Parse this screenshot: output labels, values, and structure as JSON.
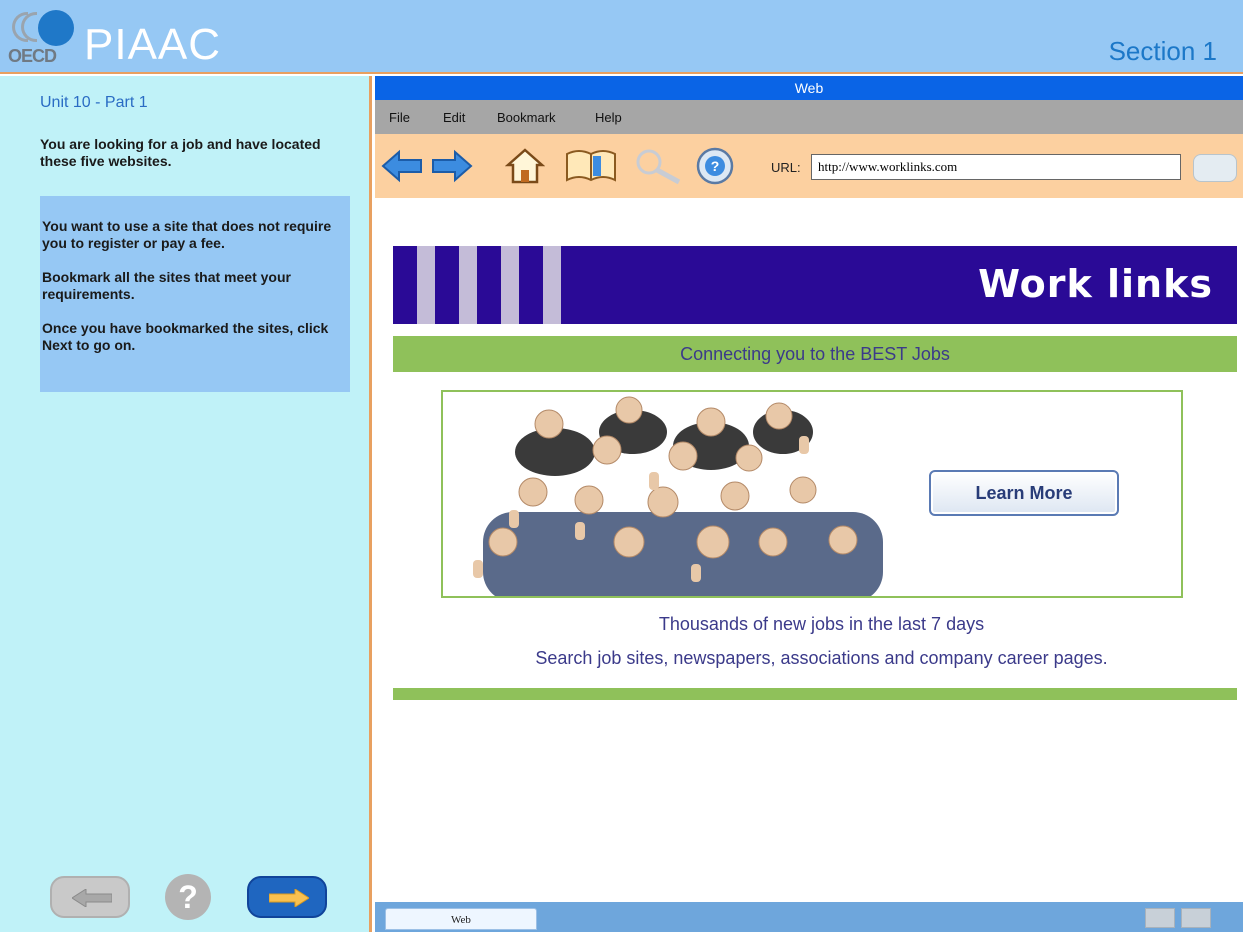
{
  "header": {
    "logo_text": "OECD",
    "brand": "PIAAC",
    "section": "Section 1"
  },
  "left_panel": {
    "unit_title": "Unit 10 - Part 1",
    "intro": "You are looking for a job and have located these five websites.",
    "instructions": [
      "You want to use a site that does not require you to register or pay a fee.",
      "Bookmark all the sites that meet your requirements.",
      "Once you have bookmarked the sites, click Next to go on."
    ],
    "nav": {
      "back_icon": "arrow-left-icon",
      "help_label": "?",
      "next_icon": "arrow-right-icon"
    }
  },
  "browser": {
    "title": "Web",
    "menu": [
      "File",
      "Edit",
      "Bookmark",
      "Help"
    ],
    "toolbar": {
      "icons": [
        "back-arrow-icon",
        "forward-arrow-icon",
        "home-icon",
        "bookmark-book-icon",
        "search-magnifier-icon",
        "help-globe-icon"
      ],
      "url_label": "URL:",
      "url_value": "http://www.worklinks.com"
    },
    "page": {
      "banner_title": "Work links",
      "tagline": "Connecting you to the BEST Jobs",
      "learn_more": "Learn More",
      "line1": "Thousands of new jobs in the last 7 days",
      "line2": "Search job sites, newspapers, associations and company career pages."
    },
    "statusbar": {
      "tab_label": "Web"
    }
  },
  "colors": {
    "header_bg": "#96c8f4",
    "left_bg": "#c0f2f8",
    "title_bar": "#0a64e6",
    "banner": "#2a0a96",
    "accent_green": "#8fc15a",
    "text_navy": "#3b3a8a"
  }
}
